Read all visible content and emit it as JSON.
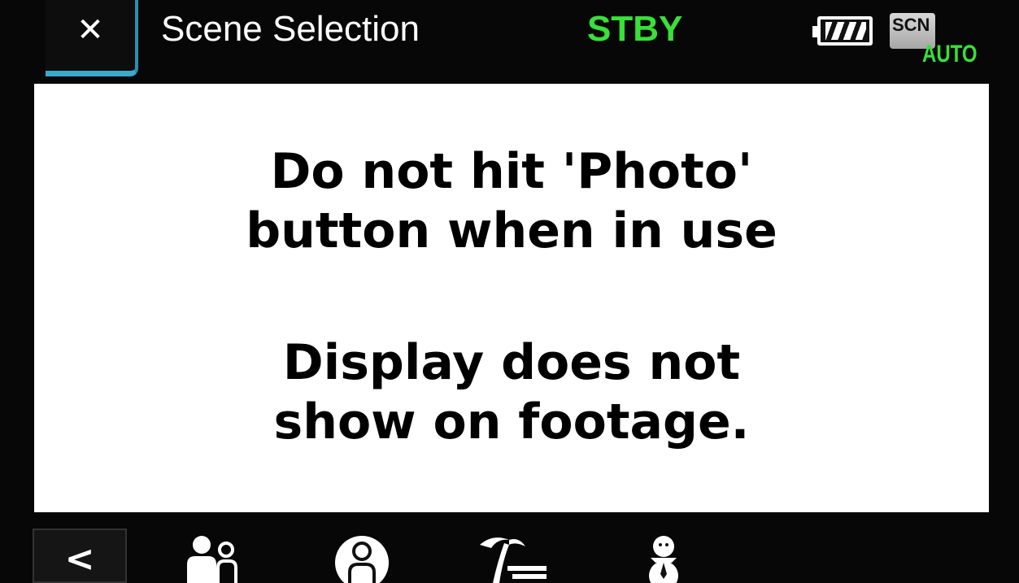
{
  "header": {
    "close_symbol": "✕",
    "title": "Scene Selection",
    "status": "STBY",
    "scene_badge": "SCN",
    "scene_mode": "AUTO"
  },
  "message": {
    "line1": "Do not hit 'Photo'",
    "line2": "button when in use",
    "line3": "Display does not",
    "line4": "show on footage."
  },
  "footer": {
    "back_symbol": "<",
    "icons": [
      "portrait-group-icon",
      "portrait-icon",
      "beach-icon",
      "snow-icon"
    ]
  },
  "colors": {
    "status_green": "#38e038",
    "accent_blue": "#3aa9cc",
    "background": "#070707",
    "panel": "#ffffff"
  }
}
